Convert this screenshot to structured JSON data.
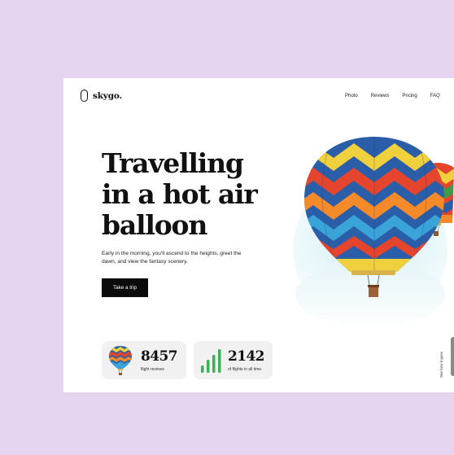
{
  "brand": {
    "name": "skygo."
  },
  "nav": {
    "items": [
      "Photo",
      "Reviews",
      "Pricing",
      "FAQ"
    ]
  },
  "hero": {
    "title_lines": [
      "Travelling",
      "in a hot air",
      "balloon"
    ],
    "subtitle": "Early in the morning, you'll ascend to the heights, greet the dawn, and view the fantasy scenery.",
    "cta_label": "Take a trip"
  },
  "stats": [
    {
      "value": "8457",
      "label": "flight reviews"
    },
    {
      "value": "2142",
      "label": "of flights in all time"
    }
  ],
  "side": {
    "label": "See how it goes"
  },
  "colors": {
    "background": "#e6d5f1",
    "card": "#ffffff",
    "button": "#0b0b0b",
    "stat_bg": "#f1f1f1",
    "bars": "#3fb05a"
  }
}
